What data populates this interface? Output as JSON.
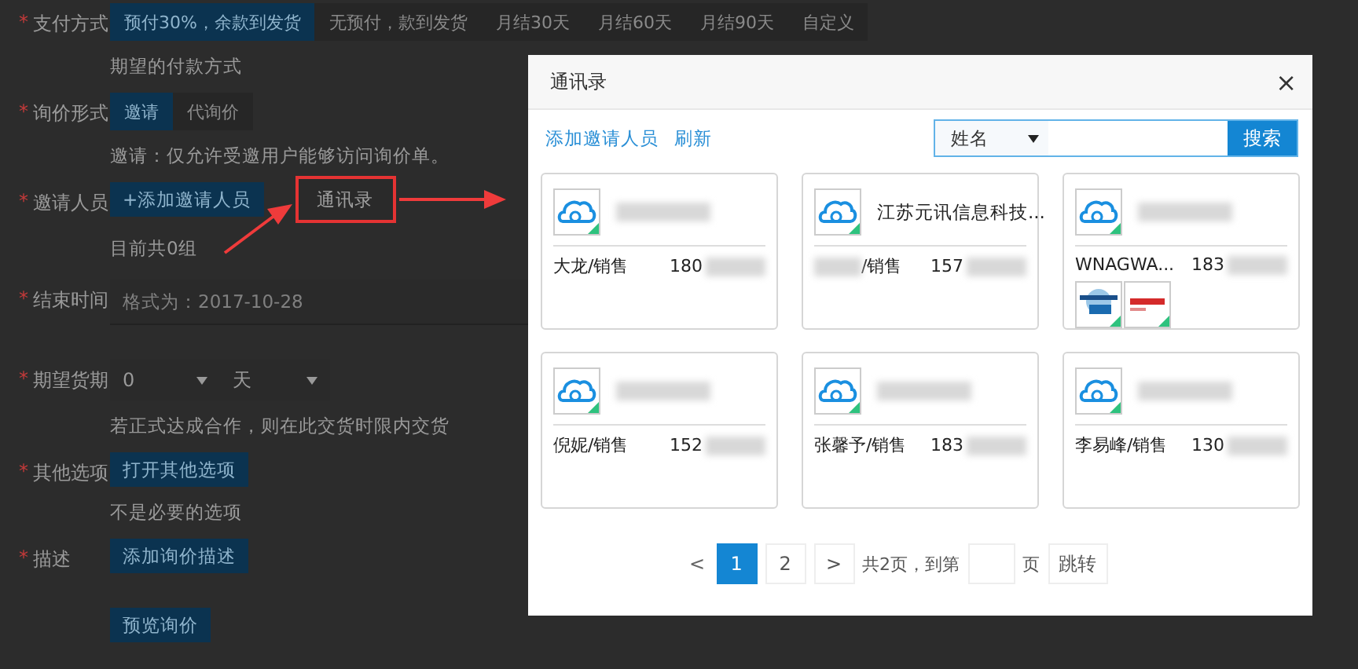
{
  "form": {
    "rows": [
      {
        "label": "支付方式",
        "required_mark": "*",
        "kind": "segmented",
        "options": [
          {
            "label": "预付30%，余款到发货",
            "selected": true
          },
          {
            "label": "无预付，款到发货",
            "selected": false
          },
          {
            "label": "月结30天",
            "selected": false
          },
          {
            "label": "月结60天",
            "selected": false
          },
          {
            "label": "月结90天",
            "selected": false
          },
          {
            "label": "自定义",
            "selected": false
          }
        ],
        "hint": "期望的付款方式"
      },
      {
        "label": "询价形式",
        "required_mark": "*",
        "kind": "segmented",
        "options": [
          {
            "label": "邀请",
            "selected": true
          },
          {
            "label": "代询价",
            "selected": false
          }
        ],
        "hint": "邀请：仅允许受邀用户能够访问询价单。"
      },
      {
        "label": "邀请人员",
        "required_mark": "*",
        "kind": "buttons",
        "buttons": [
          {
            "label": "+添加邀请人员",
            "kind": "primary"
          },
          {
            "label": "通讯录",
            "kind": "plain",
            "highlighted": true
          }
        ],
        "hint": "目前共0组"
      },
      {
        "label": "结束时间",
        "required_mark": "*",
        "kind": "input",
        "placeholder": "格式为：2017-10-28"
      },
      {
        "label": "期望货期",
        "required_mark": "*",
        "kind": "selects",
        "selects": [
          "0",
          "天"
        ],
        "hint": "若正式达成合作，则在此交货时限内交货"
      },
      {
        "label": "其他选项",
        "required_mark": "*",
        "kind": "buttons",
        "buttons": [
          {
            "label": "打开其他选项",
            "kind": "primary"
          }
        ],
        "hint": "不是必要的选项"
      },
      {
        "label": "描述",
        "required_mark": "*",
        "kind": "buttons",
        "buttons": [
          {
            "label": "添加询价描述",
            "kind": "primary"
          }
        ]
      },
      {
        "kind": "buttons",
        "buttons": [
          {
            "label": "预览询价",
            "kind": "primary"
          }
        ]
      }
    ]
  },
  "dialog": {
    "title": "通讯录",
    "close": "×",
    "links": [
      "添加邀请人员",
      "刷新"
    ],
    "search": {
      "field": "姓名",
      "button": "搜索"
    },
    "contacts": [
      {
        "name_redacted": true,
        "person": "大龙/销售",
        "phone": "180"
      },
      {
        "company": "江苏元讯信息科技...",
        "person_redacted": true,
        "person": "/销售",
        "phone": "157"
      },
      {
        "name_redacted": true,
        "person": "WNAGWA...",
        "phone": "183",
        "badges": [
          {
            "kind": "sab"
          },
          {
            "kind": "oerlikon"
          }
        ]
      },
      {
        "name_redacted": true,
        "person": "倪妮/销售",
        "phone": "152"
      },
      {
        "name_redacted": true,
        "person": "张馨予/销售",
        "phone": "183"
      },
      {
        "name_redacted": true,
        "person": "李易峰/销售",
        "phone": "130"
      }
    ],
    "pagination": {
      "prev": "<",
      "pages": [
        {
          "label": "1",
          "selected": true
        },
        {
          "label": "2",
          "selected": false
        }
      ],
      "next": ">",
      "total": "共2页，到第",
      "unit": "页",
      "go": "跳转"
    }
  }
}
